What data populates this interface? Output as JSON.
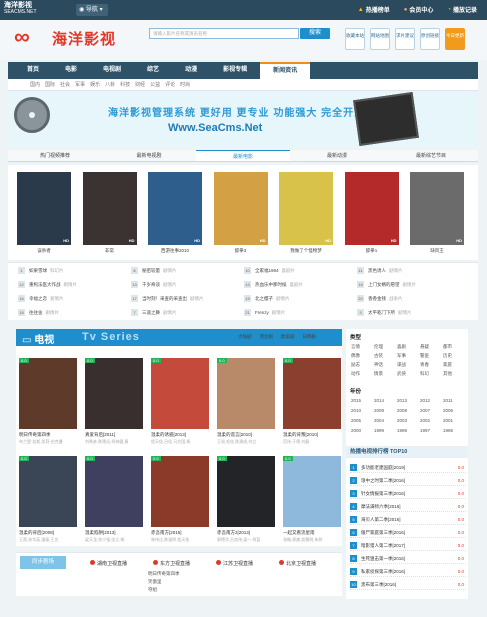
{
  "topbar": {
    "logo_line1": "海洋影视",
    "logo_line2": "SEACMS.NET",
    "nav_label": "导航",
    "links": [
      "热播榜单",
      "会员中心",
      "播放记录"
    ]
  },
  "header": {
    "brand_mark": "海洋影视",
    "search_placeholder": "请输入影片名称或演员名称",
    "search_button": "搜索",
    "quick": [
      "收藏本站",
      "网站地图",
      "求片建议",
      "原创链接",
      "今日更新"
    ]
  },
  "nav": {
    "items": [
      "首页",
      "电影",
      "电视剧",
      "综艺",
      "动漫",
      "影视专辑",
      "新闻资讯"
    ],
    "active_index": 6,
    "sub": [
      "国内",
      "国际",
      "社会",
      "军事",
      "娱乐",
      "八卦",
      "科技",
      "财经",
      "公益",
      "评论",
      "时尚"
    ]
  },
  "banner": {
    "slogan": "海洋影视管理系统 更好用 更专业 功能强大 完全开源",
    "url": "Www.SeaCms.Net"
  },
  "tabs": [
    "热门视频推荐",
    "最新电视剧",
    "最新电影",
    "最新动漫",
    "最新综艺节目"
  ],
  "tabs_active": 2,
  "posters": [
    {
      "title": "误杀者",
      "bg": "#2b3a4a"
    },
    {
      "title": "非常",
      "bg": "#3a3331"
    },
    {
      "title": "西游往事2010",
      "bg": "#2e5f8c"
    },
    {
      "title": "醉拳3",
      "bg": "#d3a043"
    },
    {
      "title": "我做了个怪物梦",
      "bg": "#d8c24a"
    },
    {
      "title": "醉拳1",
      "bg": "#b42a2a"
    },
    {
      "title": "缺风王",
      "bg": "#6b6b6b"
    }
  ],
  "ranks": [
    {
      "n": "1",
      "t": "如果雪球",
      "c": "科幻片"
    },
    {
      "n": "8",
      "t": "秘密较量",
      "c": "剧情片"
    },
    {
      "n": "10",
      "t": "全家福1984",
      "c": "喜剧片"
    },
    {
      "n": "11",
      "t": "黑色诱人",
      "c": "剧情片"
    },
    {
      "n": "12",
      "t": "重构法医大作战",
      "c": "剧情片"
    },
    {
      "n": "13",
      "t": "千岁奇谈",
      "c": "剧情片"
    },
    {
      "n": "14",
      "t": "热血乐中那时候",
      "c": "喜剧片"
    },
    {
      "n": "15",
      "t": "上门女婿的愿望",
      "c": "剧情片"
    },
    {
      "n": "16",
      "t": "幸福之恋",
      "c": "爱情片"
    },
    {
      "n": "17",
      "t": "当时刻！采查的采查出",
      "c": "剧情片"
    },
    {
      "n": "19",
      "t": "北之樱子",
      "c": "剧情片"
    },
    {
      "n": "20",
      "t": "香香金钱",
      "c": "战争片"
    },
    {
      "n": "18",
      "t": "往往舍",
      "c": "剧情片"
    },
    {
      "n": "7",
      "t": "三遥之舞",
      "c": "剧情片"
    },
    {
      "n": "21",
      "t": "Frenzy",
      "c": "剧情片"
    },
    {
      "n": "3",
      "t": "太平乾门下所",
      "c": "剧情片"
    }
  ],
  "tv": {
    "title": "电视",
    "sub": "Tv Series",
    "cats": [
      "大陆剧",
      "港台剧",
      "欧美剧",
      "日韩剧"
    ],
    "items": [
      {
        "t": "明日传奇第四季",
        "d": "布兰登·若斯,凯莉·伯克曼",
        "bg": "#5d3a2a",
        "badge": "0.0"
      },
      {
        "t": "真爱背后[2011]",
        "d": "刘希彦,陈德远,柯林健,黄",
        "bg": "#3a2f2f",
        "badge": "0.0"
      },
      {
        "t": "温柔的诱惑[2013]",
        "d": "程天佑,吕佳,马文国,杨",
        "bg": "#c44a3b",
        "badge": "0.0"
      },
      {
        "t": "温柔的谎言[2010]",
        "d": "王润,毛桂,陈建成,刘立",
        "bg": "#b88a6a",
        "badge": "0.0"
      },
      {
        "t": "温柔的背叛[2010]",
        "d": "范玮,于德,刘磊",
        "bg": "#8a3f2f",
        "badge": "0.0"
      },
      {
        "t": "温柔的背后[2008]",
        "d": "王茜,宋华英,潘泰,王文",
        "bg": "#3a4555",
        "badge": "0.0"
      },
      {
        "t": "温柔陷阱[2013]",
        "d": "梁天龙,徐少强,张立,杨",
        "bg": "#3f3f5f",
        "badge": "0.0"
      },
      {
        "t": "赤吾南方[2015]",
        "d": "林伟达,陈道明,程天佑",
        "bg": "#8b3a2a",
        "badge": "0.0"
      },
      {
        "t": "赤吾南方2[2013]",
        "d": "郭德华,吕良伟,梁一,柯蓝",
        "bg": "#222428",
        "badge": "0.0"
      },
      {
        "t": "一起又看流星雨",
        "d": "张翰,郑爽,俞灏明,朱梓",
        "bg": "#8eb8dc",
        "badge": "0.0"
      }
    ]
  },
  "side": {
    "type_title": "类型",
    "types": [
      "言情",
      "伦理",
      "喜剧",
      "悬疑",
      "都市",
      "偶像",
      "古装",
      "军事",
      "警匪",
      "历史",
      "励志",
      "神话",
      "谍战",
      "青春",
      "家庭",
      "动作",
      "情景",
      "武侠",
      "科幻",
      "其他"
    ],
    "year_title": "年份",
    "years": [
      "2015",
      "2014",
      "2013",
      "2012",
      "2011",
      "2010",
      "2009",
      "2008",
      "2007",
      "2006",
      "2005",
      "2004",
      "2003",
      "2002",
      "2001",
      "2000",
      "1999",
      "1998",
      "1997",
      "1996"
    ],
    "top_title": "热播电视排行榜 TOP10",
    "top": [
      {
        "n": "1",
        "t": "多功能老建国庭[2019]",
        "s": "0.0"
      },
      {
        "n": "2",
        "t": "琅中之时第二季[2016]",
        "s": "0.0"
      },
      {
        "n": "3",
        "t": "针女情报第三季[2016]",
        "s": "0.0"
      },
      {
        "n": "4",
        "t": "摩法满师六季[2016]",
        "s": "0.0"
      },
      {
        "n": "5",
        "t": "海贝人第二季[2016]",
        "s": "0.0"
      },
      {
        "n": "6",
        "t": "僵尸家庭第三季[2016]",
        "s": "0.0"
      },
      {
        "n": "7",
        "t": "暗影猎人第二季[2017]",
        "s": "0.0"
      },
      {
        "n": "8",
        "t": "生死狙击第一季[2016]",
        "s": "0.0"
      },
      {
        "n": "9",
        "t": "私家侦探第三季[2016]",
        "s": "0.0"
      },
      {
        "n": "10",
        "t": "黑布第三季[2016]",
        "s": "0.0"
      }
    ]
  },
  "live": {
    "tab": "同步剧场",
    "channels": [
      "湖南卫视直播",
      "东方卫视直播",
      "江苏卫视直播",
      "北京卫视直播"
    ],
    "sub": [
      "明日传奇第四季",
      "笑傲里",
      "夺组"
    ]
  }
}
